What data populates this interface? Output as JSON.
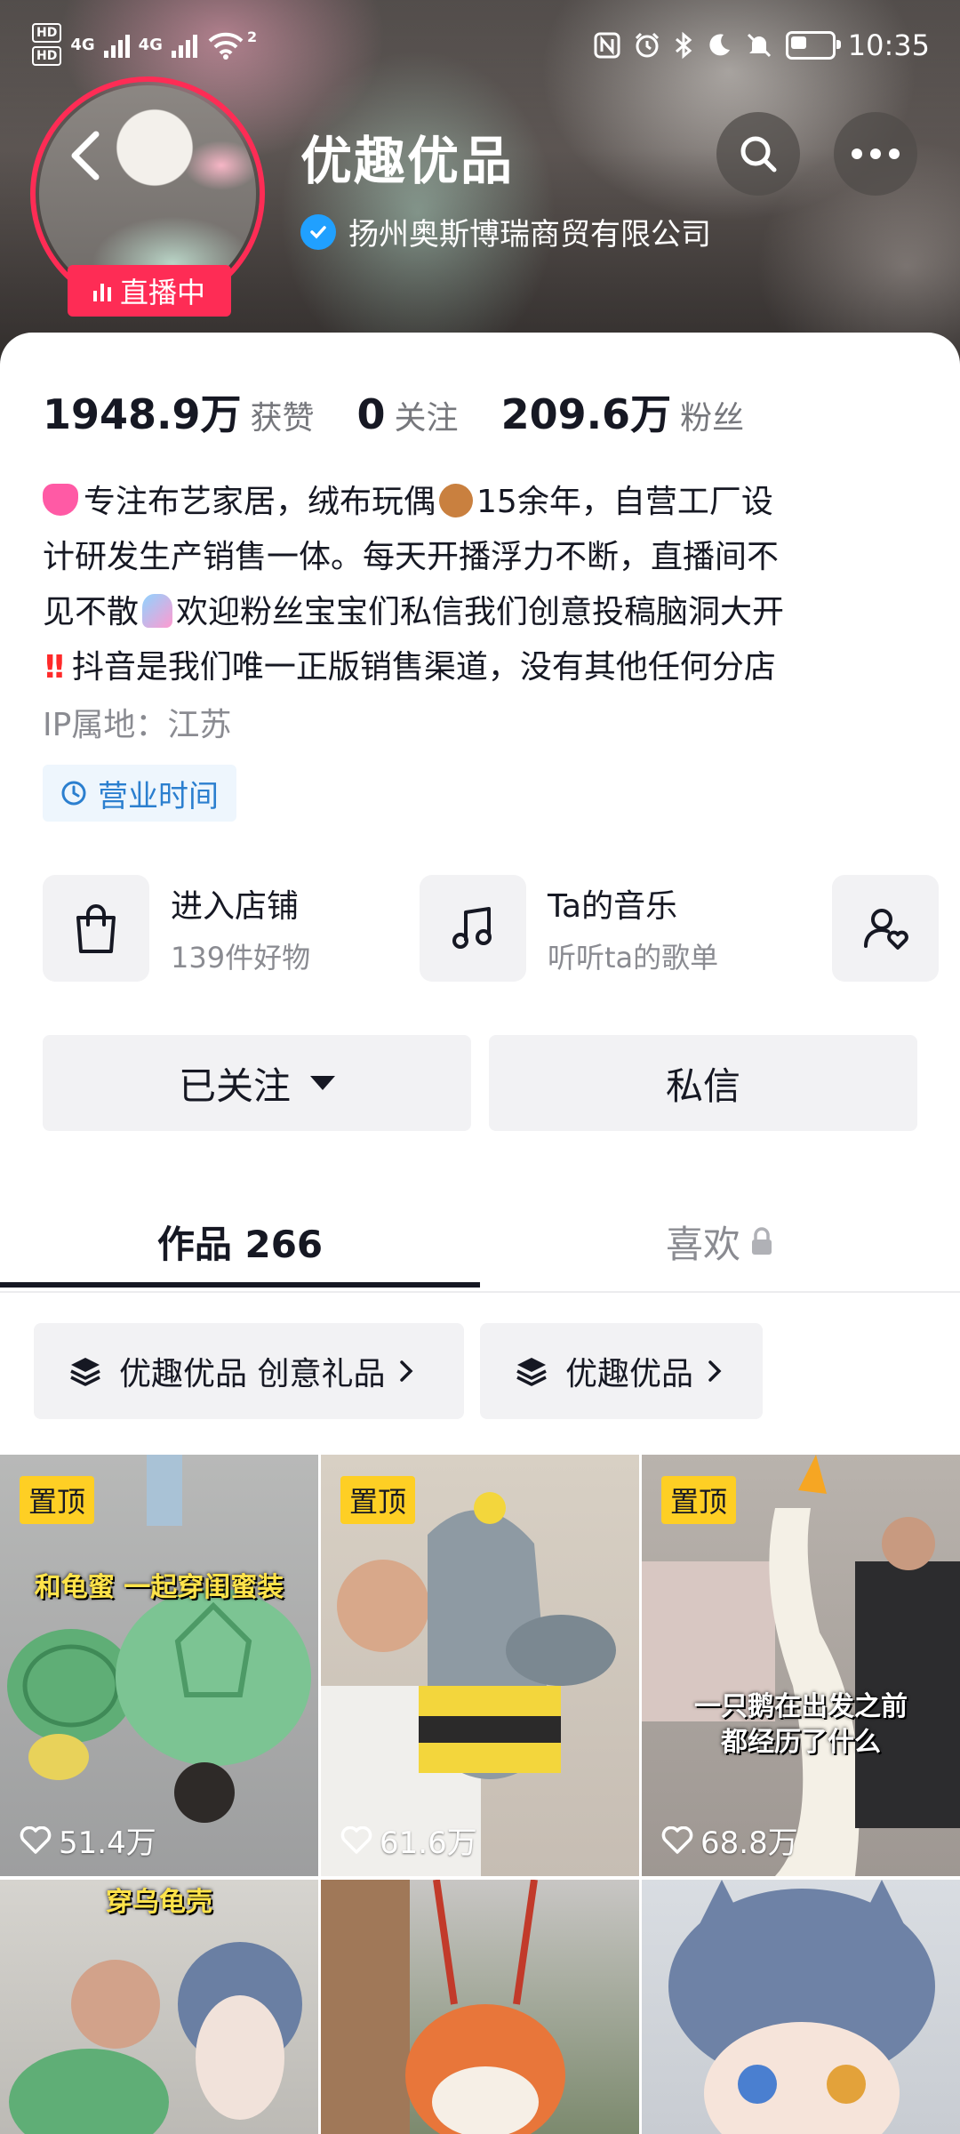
{
  "status_bar": {
    "left_indicators": [
      "HD",
      "HD",
      "4G",
      "4G"
    ],
    "wifi_level": "2",
    "icons": [
      "nfc-icon",
      "alarm-icon",
      "bluetooth-icon",
      "moon-icon",
      "mute-icon"
    ],
    "battery_level": 0.45,
    "time": "10:35"
  },
  "header": {
    "name": "优趣优品",
    "verified_company": "扬州奥斯博瑞商贸有限公司",
    "live_label": "直播中"
  },
  "stats": [
    {
      "value": "1948.9万",
      "label": "获赞"
    },
    {
      "value": "0",
      "label": "关注"
    },
    {
      "value": "209.6万",
      "label": "粉丝"
    }
  ],
  "bio": {
    "line1_a": "专注布艺家居，绒布玩偶",
    "line1_b": "15余年，自营工厂设",
    "line2": "计研发生产销售一体。每天开播浮力不断，直播间不",
    "line3_a": "见不散",
    "line3_b": "欢迎粉丝宝宝们私信我们创意投稿脑洞大开",
    "line4_mark": "!!",
    "line4": "抖音是我们唯一正版销售渠道，没有其他任何分店"
  },
  "ip_location": "IP属地：江苏",
  "business_hours": "营业时间",
  "services": [
    {
      "title": "进入店铺",
      "subtitle": "139件好物"
    },
    {
      "title": "Ta的音乐",
      "subtitle": "听听ta的歌单"
    }
  ],
  "actions": {
    "follow": "已关注",
    "message": "私信"
  },
  "tabs": {
    "works": "作品 266",
    "likes": "喜欢"
  },
  "collections": [
    {
      "label": "优趣优品 创意礼品"
    },
    {
      "label": "优趣优品"
    }
  ],
  "videos": [
    {
      "pinned": "置顶",
      "likes": "51.4万",
      "caption": "和龟蜜 一起穿闺蜜装"
    },
    {
      "pinned": "置顶",
      "likes": "61.6万",
      "caption": ""
    },
    {
      "pinned": "置顶",
      "likes": "68.8万",
      "caption_line1": "一只鹅在出发之前",
      "caption_line2": "都经历了什么"
    },
    {
      "pinned": "",
      "likes": "",
      "caption": "穿乌龟壳"
    },
    {
      "pinned": "",
      "likes": "",
      "caption": ""
    },
    {
      "pinned": "",
      "likes": "",
      "caption": ""
    }
  ],
  "colors": {
    "live_red": "#fe2c55",
    "verify_blue": "#20a0ff",
    "pin_yellow": "#fecf24",
    "hours_blue": "#2b7fcf"
  }
}
